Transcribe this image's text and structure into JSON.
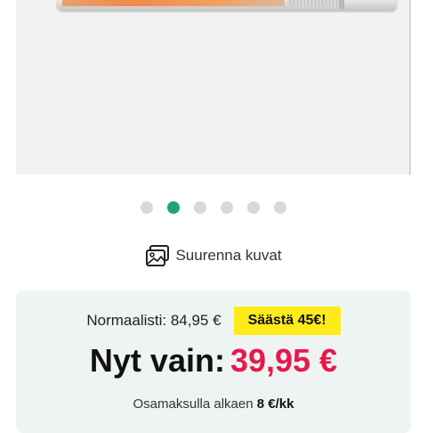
{
  "gallery": {
    "slide_count": 6,
    "active_slide": 2,
    "image_icon": "product-heater-image"
  },
  "zoom": {
    "icon": "image-gallery-icon",
    "label": "Suurenna kuvat"
  },
  "pricing": {
    "normal_price": "Normaalisti: 84,95 €",
    "save_badge": "Säästä 45€!",
    "now_label": "Nyt vain:",
    "now_price": "39,95 €",
    "installment_prefix": "Osamaksulla alkaen",
    "installment_amount": "8 €/kk",
    "colors": {
      "price_accent": "#e6194b",
      "badge_bg": "#ffeb1a",
      "active_dot": "#1fa37a",
      "box_bg": "#eef4f2"
    }
  }
}
